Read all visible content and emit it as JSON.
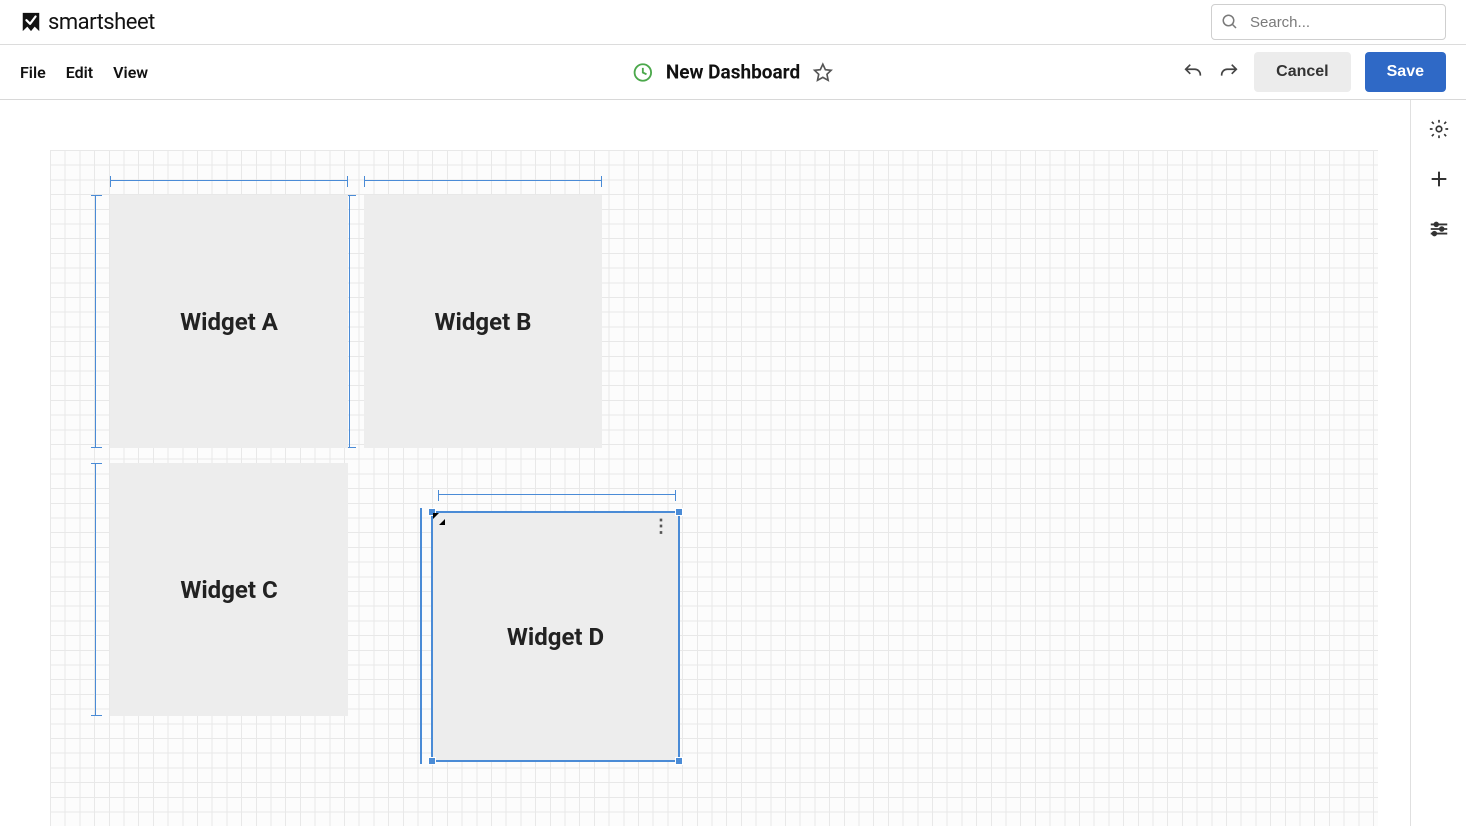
{
  "app": {
    "brand": "smartsheet"
  },
  "search": {
    "placeholder": "Search..."
  },
  "menus": {
    "file": "File",
    "edit": "Edit",
    "view": "View"
  },
  "dashboard": {
    "title": "New Dashboard"
  },
  "actions": {
    "cancel": "Cancel",
    "save": "Save"
  },
  "widgets": {
    "a": "Widget A",
    "b": "Widget B",
    "c": "Widget C",
    "d": "Widget D"
  }
}
